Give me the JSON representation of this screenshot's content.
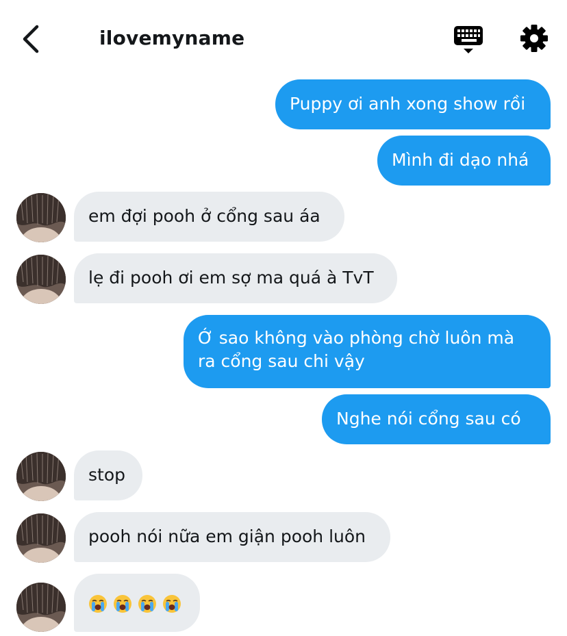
{
  "header": {
    "title": "ilovemyname",
    "back_icon": "chevron-left-icon",
    "keyboard_icon": "keyboard-icon",
    "settings_icon": "gear-icon"
  },
  "colors": {
    "outgoing_bubble": "#1d9bf0",
    "incoming_bubble": "#e9ecef",
    "text_dark": "#14171a"
  },
  "messages": [
    {
      "direction": "out",
      "text": "Puppy ơi anh xong show rồi"
    },
    {
      "direction": "out",
      "text": "Mình đi dạo nhá"
    },
    {
      "direction": "in",
      "text": "em đợi pooh ở cổng sau áa"
    },
    {
      "direction": "in",
      "text": "lẹ đi pooh ơi em sợ ma quá à TvT"
    },
    {
      "direction": "out",
      "text": "Ớ sao không vào phòng chờ luôn mà ra cổng sau chi vậy"
    },
    {
      "direction": "out",
      "text": "Nghe nói cổng sau có"
    },
    {
      "direction": "in",
      "text": "stop"
    },
    {
      "direction": "in",
      "text": "pooh nói nữa em giận pooh luôn"
    },
    {
      "direction": "in",
      "text": "",
      "emojis": [
        "loudly-crying-face-icon",
        "loudly-crying-face-icon",
        "loudly-crying-face-icon",
        "loudly-crying-face-icon"
      ]
    }
  ]
}
